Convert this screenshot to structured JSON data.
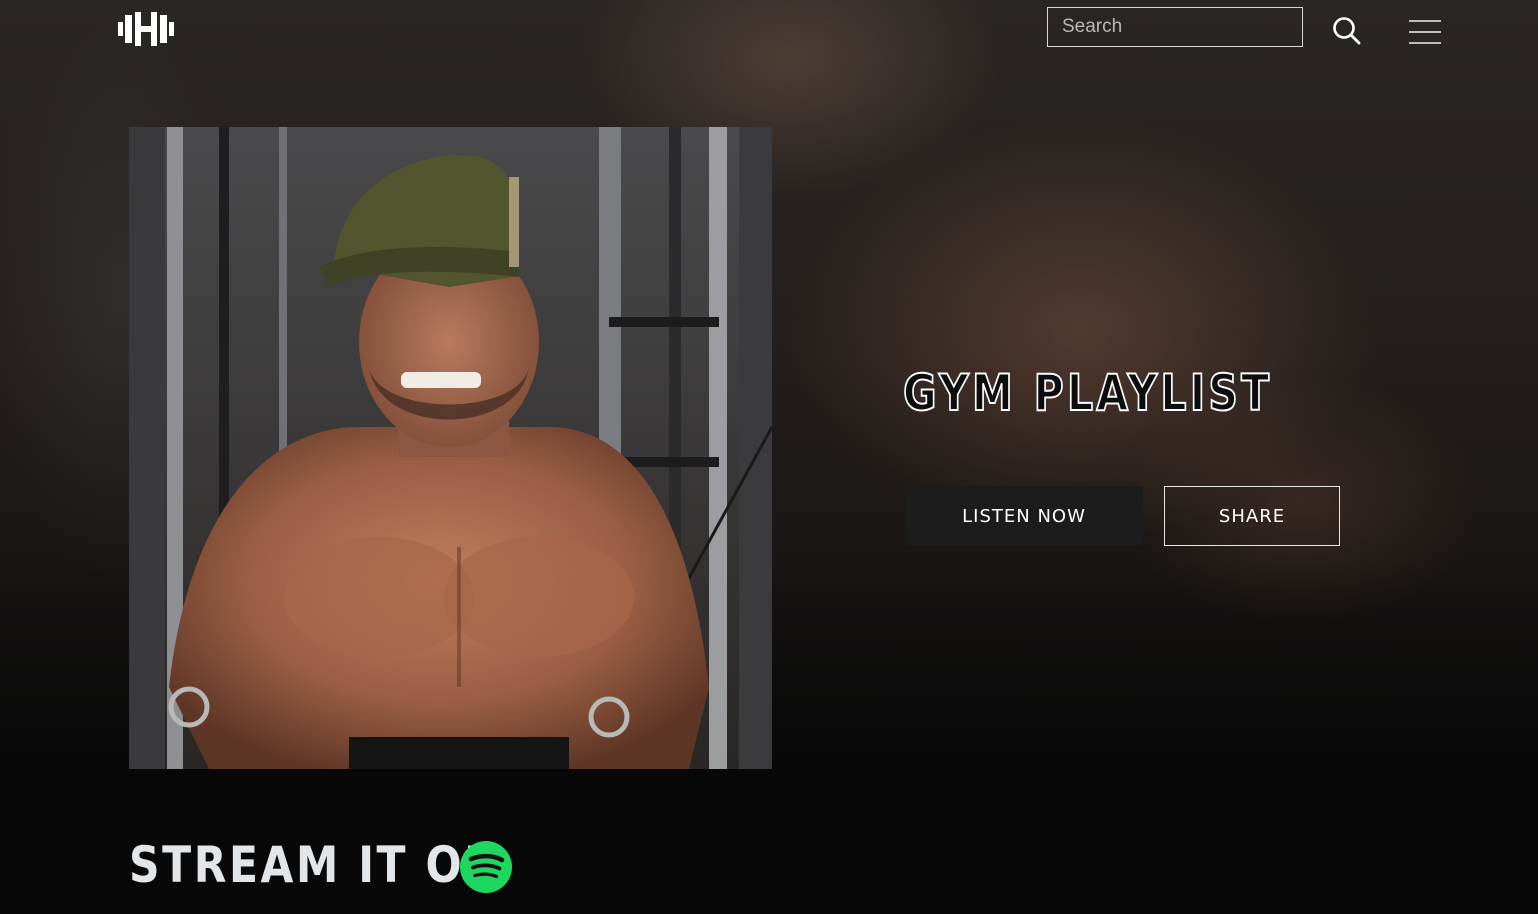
{
  "header": {
    "logo_icon": "dumbbell-h-icon",
    "search": {
      "placeholder": "Search",
      "value": ""
    },
    "search_icon": "search-icon",
    "menu_icon": "hamburger-menu-icon"
  },
  "hero": {
    "title": "GYM PLAYLIST",
    "listen_label": "LISTEN NOW",
    "share_label": "SHARE"
  },
  "stream": {
    "label": "STREAM IT ON",
    "service_icon": "spotify-icon"
  },
  "colors": {
    "background": "#080808",
    "listen_button": "#1c1c1c",
    "spotify_green": "#1ed760",
    "text": "#ffffff"
  }
}
